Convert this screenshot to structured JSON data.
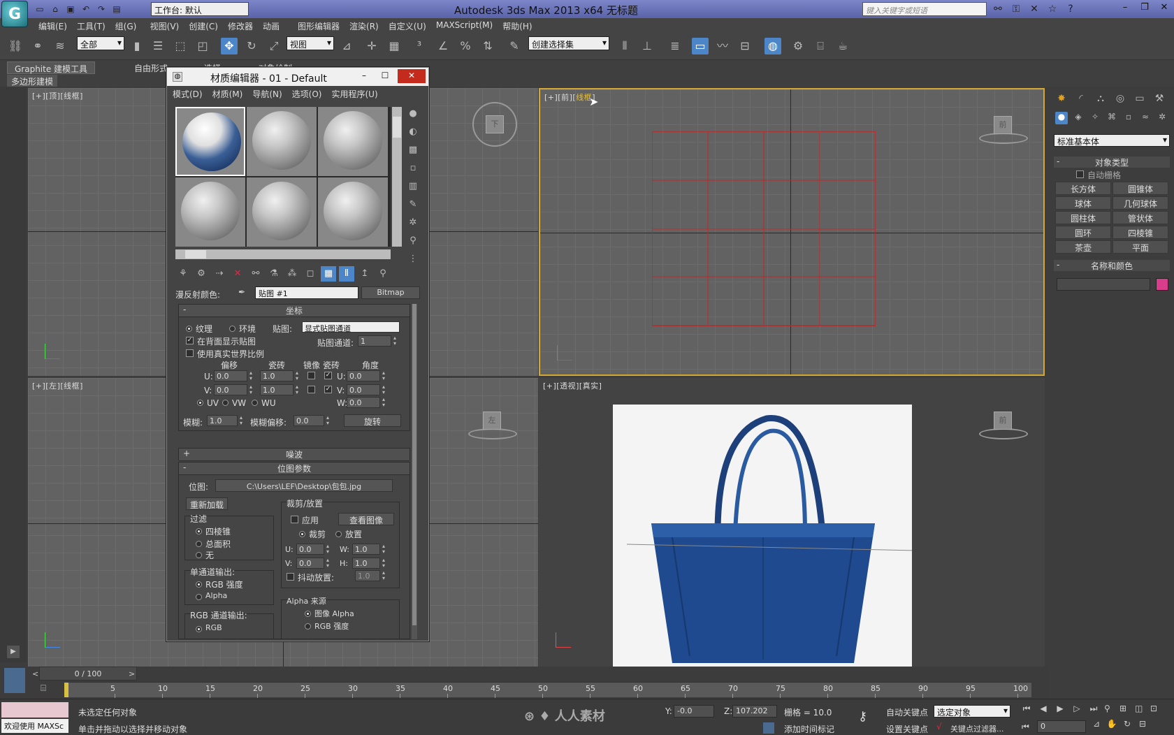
{
  "titlebar": {
    "workspace": "工作台: 默认",
    "title": "Autodesk 3ds Max  2013 x64      无标题",
    "search_placeholder": "键入关键字或短语"
  },
  "menu": [
    "编辑(E)",
    "工具(T)",
    "组(G)",
    "视图(V)",
    "创建(C)",
    "修改器",
    "动画",
    "图形编辑器",
    "渲染(R)",
    "自定义(U)",
    "MAXScript(M)",
    "帮助(H)"
  ],
  "toolbar": {
    "filter": "全部",
    "refcoord": "视图",
    "selection_set": "创建选择集"
  },
  "ribbon": {
    "tabs": [
      "Graphite 建模工具",
      "自由形式",
      "选择",
      "对象绘制"
    ],
    "sub": "多边形建模"
  },
  "viewports": {
    "top": {
      "label": "[+][顶][线框]",
      "cube": "下"
    },
    "front": {
      "label_pre": "[+][前][",
      "label_hl": "线框",
      "label_post": "]",
      "cube": "前"
    },
    "left": {
      "label": "[+][左][线框]",
      "cube": "左"
    },
    "persp": {
      "label": "[+][透视][真实]",
      "cube": "前"
    }
  },
  "material_editor": {
    "title": "材质编辑器 - 01 - Default",
    "menu": [
      "模式(D)",
      "材质(M)",
      "导航(N)",
      "选项(O)",
      "实用程序(U)"
    ],
    "diffuse_label": "漫反射颜色:",
    "map_name": "贴图 #1",
    "map_type": "Bitmap",
    "coords": {
      "header": "坐标",
      "texture": "纹理",
      "environ": "环境",
      "mapping_label": "贴图:",
      "mapping": "显式贴图通道",
      "show_back": "在背面显示贴图",
      "map_channel_label": "贴图通道:",
      "map_channel": "1",
      "real_world": "使用真实世界比例",
      "offset": "偏移",
      "tiling": "瓷砖",
      "mirror": "镜像",
      "tile": "瓷砖",
      "angle": "角度",
      "u_offset": "0.0",
      "v_offset": "0.0",
      "u_tiling": "1.0",
      "v_tiling": "1.0",
      "u_angle": "0.0",
      "v_angle": "0.0",
      "w_angle": "0.0",
      "uv": "UV",
      "vw": "VW",
      "wu": "WU",
      "blur_label": "模糊:",
      "blur": "1.0",
      "blur_offset_label": "模糊偏移:",
      "blur_offset": "0.0",
      "rotate": "旋转",
      "u": "U:",
      "v": "V:",
      "w": "W:"
    },
    "noise_header": "噪波",
    "bitmap": {
      "header": "位图参数",
      "bitmap_label": "位图:",
      "path": "C:\\Users\\LEF\\Desktop\\包包.jpg",
      "reload": "重新加载",
      "crop_title": "裁剪/放置",
      "apply": "应用",
      "view_image": "查看图像",
      "crop": "裁剪",
      "place": "放置",
      "u": "0.0",
      "v": "0.0",
      "w": "1.0",
      "h": "1.0",
      "jitter_label": "抖动放置:",
      "jitter": "1.0",
      "filter_title": "过滤",
      "filter_pyramidal": "四棱锥",
      "filter_sat": "总面积",
      "filter_none": "无",
      "mono_title": "单通道输出:",
      "rgb_intensity": "RGB 强度",
      "alpha": "Alpha",
      "alpha_source_title": "Alpha 来源",
      "image_alpha": "图像 Alpha",
      "alpha_rgb_intensity": "RGB 强度",
      "rgb_out_title": "RGB 通道输出:",
      "rgb": "RGB"
    }
  },
  "command_panel": {
    "dropdown": "标准基本体",
    "object_type": "对象类型",
    "autogrid": "自动栅格",
    "buttons": [
      "长方体",
      "圆锥体",
      "球体",
      "几何球体",
      "圆柱体",
      "管状体",
      "圆环",
      "四棱锥",
      "茶壶",
      "平面"
    ],
    "name_color": "名称和颜色",
    "color": "#d83c8c"
  },
  "timeline": {
    "slider": "0 / 100",
    "ticks": [
      "5",
      "10",
      "15",
      "20",
      "25",
      "30",
      "35",
      "40",
      "45",
      "50",
      "55",
      "60",
      "65",
      "70",
      "75",
      "80",
      "85",
      "90",
      "95",
      "100"
    ]
  },
  "status": {
    "maxscript": "欢迎使用 MAXSc",
    "line1": "未选定任何对象",
    "line2": "单击并拖动以选择并移动对象",
    "y_label": "Y:",
    "y": "-0.0",
    "z_label": "Z:",
    "z": "107.202",
    "grid": "栅格 = 10.0",
    "auto_key": "自动关键点",
    "selected": "选定对象",
    "set_key": "设置关键点",
    "key_filters": "关键点过滤器...",
    "add_time_tag": "添加时间标记",
    "frame": "0"
  }
}
